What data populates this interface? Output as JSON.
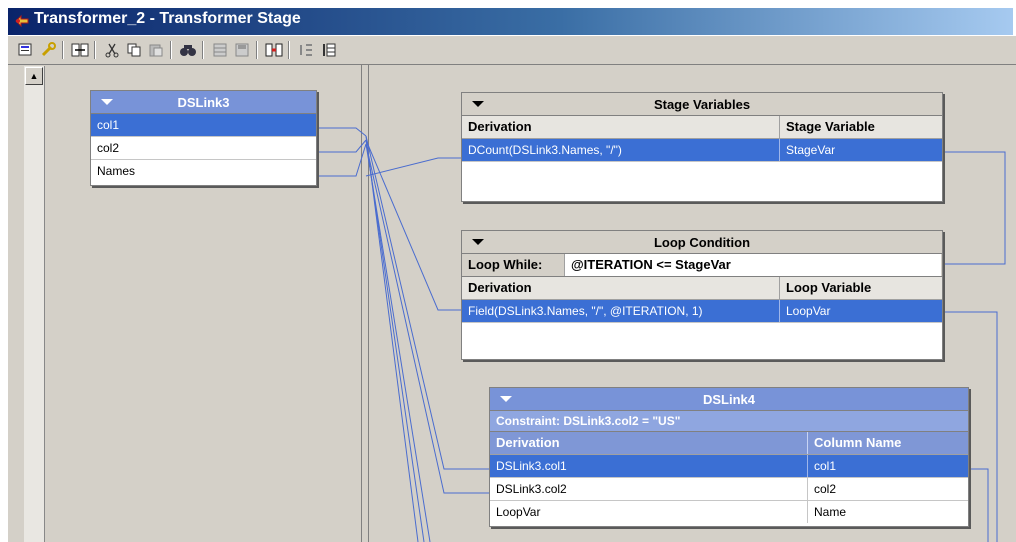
{
  "window": {
    "title": "Transformer_2 - Transformer Stage",
    "icon": "transformer-stage-icon"
  },
  "toolbar": {
    "icons": [
      "stage-properties-icon",
      "constraints-icon",
      "column-auto-match-icon",
      "cut-icon",
      "copy-icon",
      "paste-icon",
      "find-replace-icon",
      "load-column-icon",
      "save-column-icon",
      "input-link-execution-order-icon",
      "output-link-execution-order-icon",
      "show-all-relations-icon"
    ]
  },
  "dslink3": {
    "title": "DSLink3",
    "rows": [
      "col1",
      "col2",
      "Names"
    ]
  },
  "stage_variables": {
    "title": "Stage Variables",
    "col_derivation": "Derivation",
    "col_variable": "Stage Variable",
    "rows": [
      {
        "derivation": "DCount(DSLink3.Names, \"/\")",
        "name": "StageVar"
      }
    ]
  },
  "loop_condition": {
    "title": "Loop Condition",
    "while_label": "Loop While:",
    "while_expr": "@ITERATION <= StageVar",
    "col_derivation": "Derivation",
    "col_variable": "Loop Variable",
    "rows": [
      {
        "derivation": "Field(DSLink3.Names, \"/\", @ITERATION, 1)",
        "name": "LoopVar"
      }
    ]
  },
  "dslink4": {
    "title": "DSLink4",
    "constraint": "Constraint: DSLink3.col2 = \"US\"",
    "col_derivation": "Derivation",
    "col_name": "Column Name",
    "rows": [
      {
        "derivation": "DSLink3.col1",
        "name": "col1"
      },
      {
        "derivation": "DSLink3.col2",
        "name": "col2"
      },
      {
        "derivation": "LoopVar",
        "name": "Name"
      }
    ]
  }
}
